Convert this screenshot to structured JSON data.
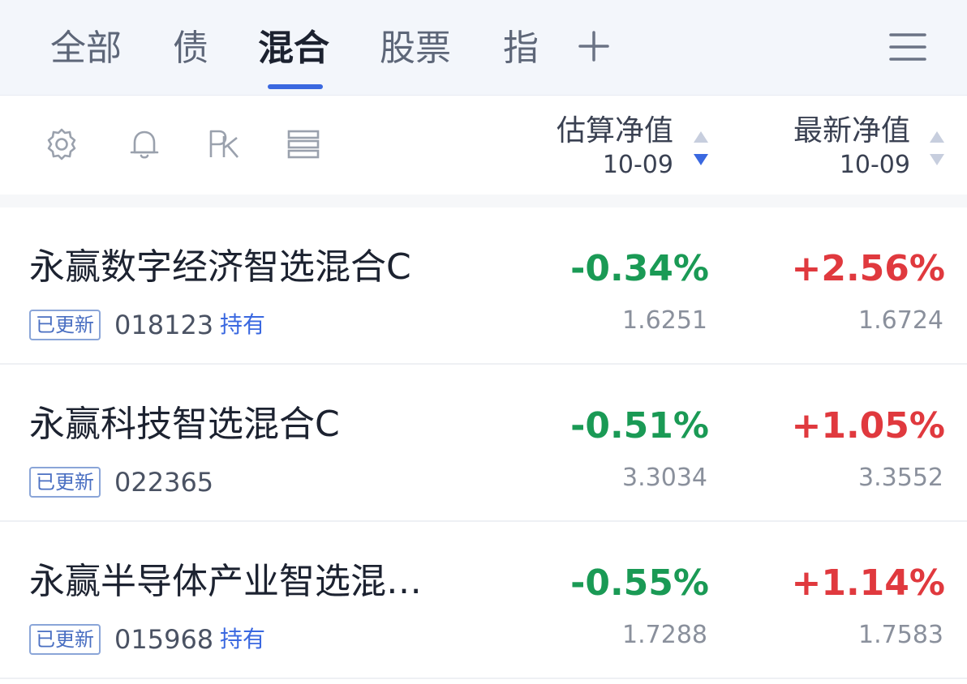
{
  "tabs": [
    "全部",
    "债",
    "混合",
    "股票",
    "指"
  ],
  "active_tab": "混合",
  "header": {
    "tools": [
      "gear-icon",
      "bell-icon",
      "rk-icon",
      "list-icon"
    ],
    "col_estimated": {
      "title": "估算净值",
      "date": "10-09"
    },
    "col_latest": {
      "title": "最新净值",
      "date": "10-09"
    },
    "sort_state": {
      "estimated": "descending",
      "latest": "none"
    }
  },
  "badge_label": "已更新",
  "hold_label": "持有",
  "colors": {
    "accent": "#3a68e0",
    "down": "#1a9a55",
    "up": "#e0393e"
  },
  "funds": [
    {
      "name": "永赢数字经济智选混合C",
      "code": "018123",
      "hold": "持有",
      "est_change": "-0.34%",
      "est_nav": "1.6251",
      "latest_change": "+2.56%",
      "latest_nav": "1.6724"
    },
    {
      "name": "永赢科技智选混合C",
      "code": "022365",
      "hold": "",
      "est_change": "-0.51%",
      "est_nav": "3.3034",
      "latest_change": "+1.05%",
      "latest_nav": "3.3552"
    },
    {
      "name": "永赢半导体产业智选混…",
      "code": "015968",
      "hold": "持有",
      "est_change": "-0.55%",
      "est_nav": "1.7288",
      "latest_change": "+1.14%",
      "latest_nav": "1.7583"
    }
  ]
}
